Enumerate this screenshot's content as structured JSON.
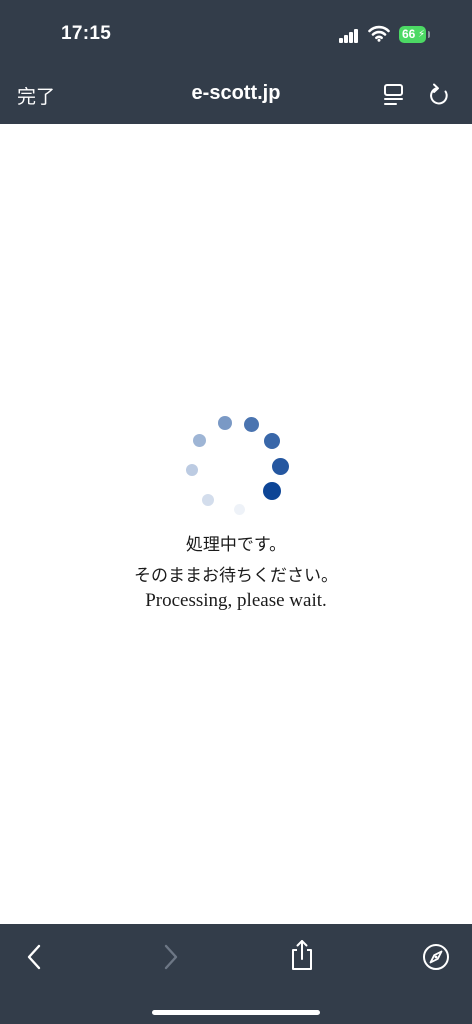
{
  "status_bar": {
    "time": "17:15",
    "battery_level": "66",
    "battery_color": "#4cd964",
    "signal_icon": "cellular-signal-icon",
    "wifi_icon": "wifi-icon",
    "charging_icon": "charging-bolt-icon"
  },
  "browser_header": {
    "done_label": "完了",
    "url": "e-scott.jp",
    "reader_icon": "reader-view-icon",
    "reload_icon": "reload-icon",
    "background_color": "#333d4a"
  },
  "content": {
    "spinner_icon": "loading-spinner-icon",
    "spinner_color": "#0d4596",
    "message_ja_1": "処理中です。",
    "message_ja_2": "そのままお待ちください。",
    "message_en": "Processing, please wait."
  },
  "toolbar": {
    "back_icon": "chevron-left-icon",
    "forward_icon": "chevron-right-icon",
    "forward_enabled": false,
    "share_icon": "share-icon",
    "safari_icon": "compass-icon"
  }
}
